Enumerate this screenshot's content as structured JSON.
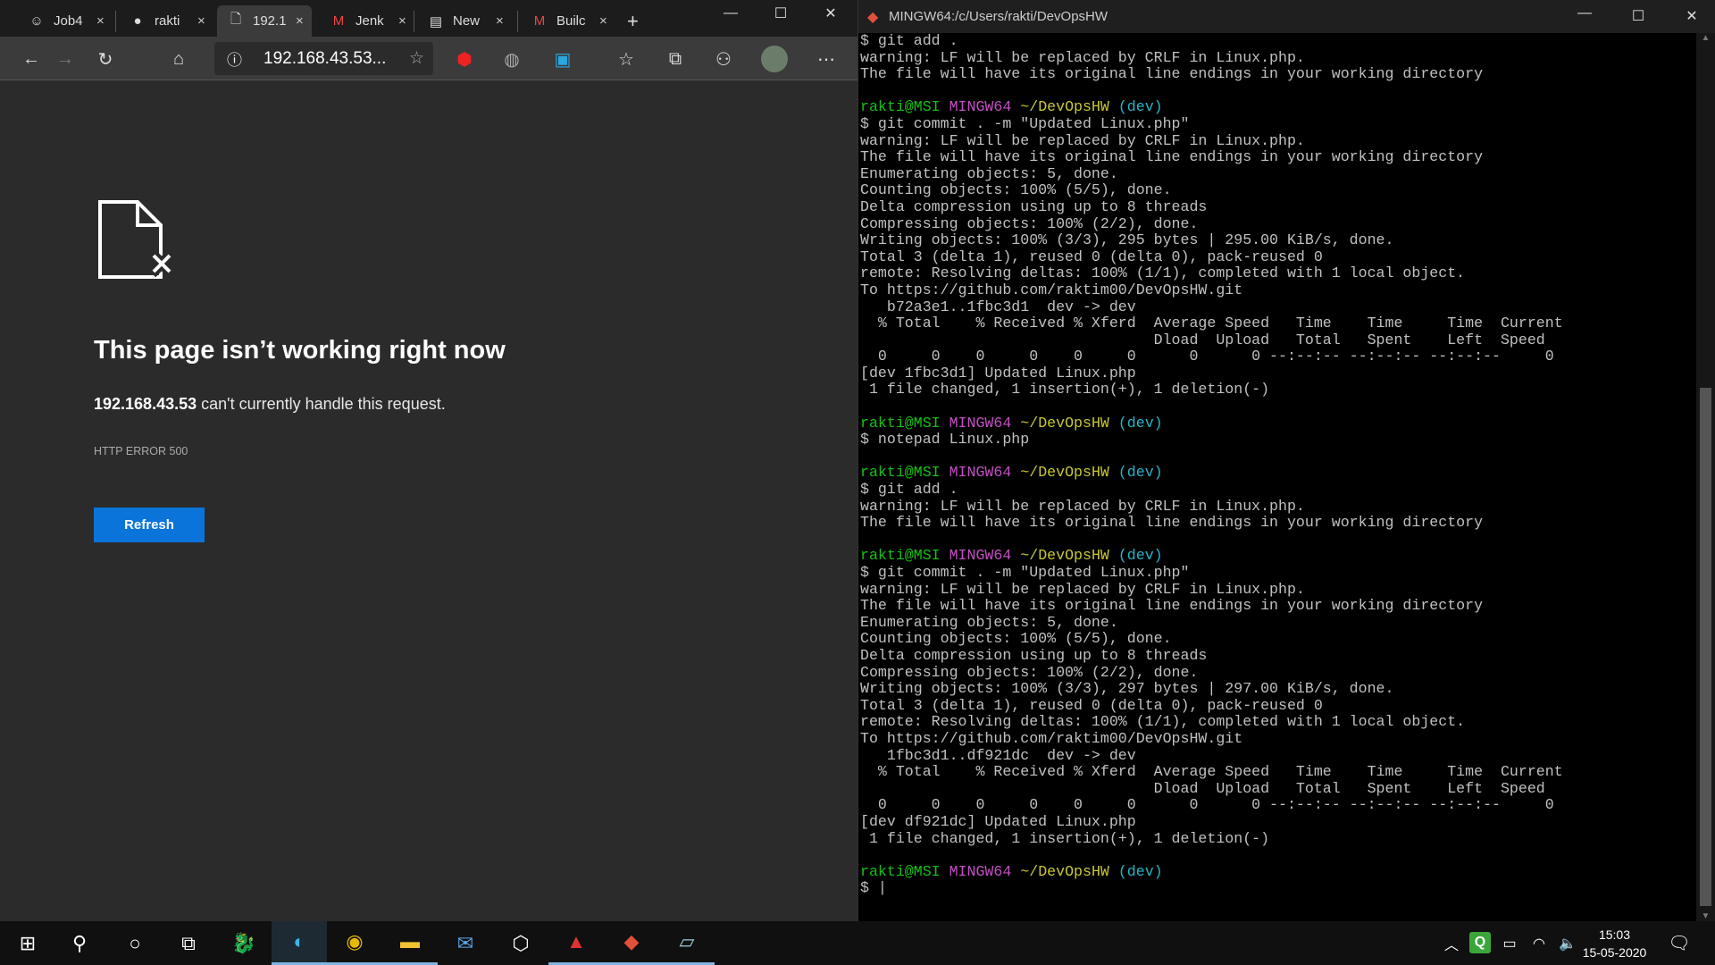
{
  "browser": {
    "tabs": [
      {
        "label": "Job4",
        "icon": "jenkins-icon",
        "glyph": "☺"
      },
      {
        "label": "rakti",
        "icon": "github-icon",
        "glyph": "●"
      },
      {
        "label": "192.1",
        "icon": "broken-page-icon",
        "glyph": "🗋",
        "active": true
      },
      {
        "label": "Jenk",
        "icon": "gmail-icon",
        "glyph": "M"
      },
      {
        "label": "New",
        "icon": "news-icon",
        "glyph": "▤"
      },
      {
        "label": "Builc",
        "icon": "gmail-icon",
        "glyph": "M"
      }
    ],
    "close_glyph": "×",
    "new_tab_glyph": "+",
    "address": "192.168.43.53...",
    "error": {
      "title": "This page isn’t working right now",
      "host": "192.168.43.53",
      "message": " can't currently handle this request.",
      "code": "HTTP ERROR 500",
      "refresh_label": "Refresh"
    }
  },
  "terminal": {
    "title": "MINGW64:/c/Users/rakti/DevOpsHW",
    "prompt": {
      "user": "rakti@MSI",
      "sys": "MINGW64",
      "path": "~/DevOpsHW",
      "branch": "(dev)"
    },
    "lines": [
      "$ git add .",
      "warning: LF will be replaced by CRLF in Linux.php.",
      "The file will have its original line endings in your working directory",
      "",
      "@prompt",
      "$ git commit . -m \"Updated Linux.php\"",
      "warning: LF will be replaced by CRLF in Linux.php.",
      "The file will have its original line endings in your working directory",
      "Enumerating objects: 5, done.",
      "Counting objects: 100% (5/5), done.",
      "Delta compression using up to 8 threads",
      "Compressing objects: 100% (2/2), done.",
      "Writing objects: 100% (3/3), 295 bytes | 295.00 KiB/s, done.",
      "Total 3 (delta 1), reused 0 (delta 0), pack-reused 0",
      "remote: Resolving deltas: 100% (1/1), completed with 1 local object.",
      "To https://github.com/raktim00/DevOpsHW.git",
      "   b72a3e1..1fbc3d1  dev -> dev",
      "  % Total    % Received % Xferd  Average Speed   Time    Time     Time  Current",
      "                                 Dload  Upload   Total   Spent    Left  Speed",
      "  0     0    0     0    0     0      0      0 --:--:-- --:--:-- --:--:--     0",
      "[dev 1fbc3d1] Updated Linux.php",
      " 1 file changed, 1 insertion(+), 1 deletion(-)",
      "",
      "@prompt",
      "$ notepad Linux.php",
      "",
      "@prompt",
      "$ git add .",
      "warning: LF will be replaced by CRLF in Linux.php.",
      "The file will have its original line endings in your working directory",
      "",
      "@prompt",
      "$ git commit . -m \"Updated Linux.php\"",
      "warning: LF will be replaced by CRLF in Linux.php.",
      "The file will have its original line endings in your working directory",
      "Enumerating objects: 5, done.",
      "Counting objects: 100% (5/5), done.",
      "Delta compression using up to 8 threads",
      "Compressing objects: 100% (2/2), done.",
      "Writing objects: 100% (3/3), 297 bytes | 297.00 KiB/s, done.",
      "Total 3 (delta 1), reused 0 (delta 0), pack-reused 0",
      "remote: Resolving deltas: 100% (1/1), completed with 1 local object.",
      "To https://github.com/raktim00/DevOpsHW.git",
      "   1fbc3d1..df921dc  dev -> dev",
      "  % Total    % Received % Xferd  Average Speed   Time    Time     Time  Current",
      "                                 Dload  Upload   Total   Spent    Left  Speed",
      "  0     0    0     0    0     0      0      0 --:--:-- --:--:-- --:--:--     0",
      "[dev df921dc] Updated Linux.php",
      " 1 file changed, 1 insertion(+), 1 deletion(-)",
      "",
      "@prompt",
      "$ |"
    ]
  },
  "taskbar": {
    "time": "15:03",
    "date": "15-05-2020",
    "apps": [
      "start-icon",
      "search-icon",
      "cortana-icon",
      "task-view-icon",
      "msi-dragon-icon",
      "edge-icon",
      "chrome-icon",
      "file-explorer-icon",
      "mail-icon",
      "virtualbox-icon",
      "rufus-icon",
      "git-bash-icon",
      "notepad-icon"
    ]
  },
  "colors": {
    "accent": "#0a74da",
    "prompt_user": "#13c313",
    "prompt_sys": "#c44fc4",
    "prompt_path": "#c8c832",
    "prompt_branch": "#27b5c8"
  }
}
